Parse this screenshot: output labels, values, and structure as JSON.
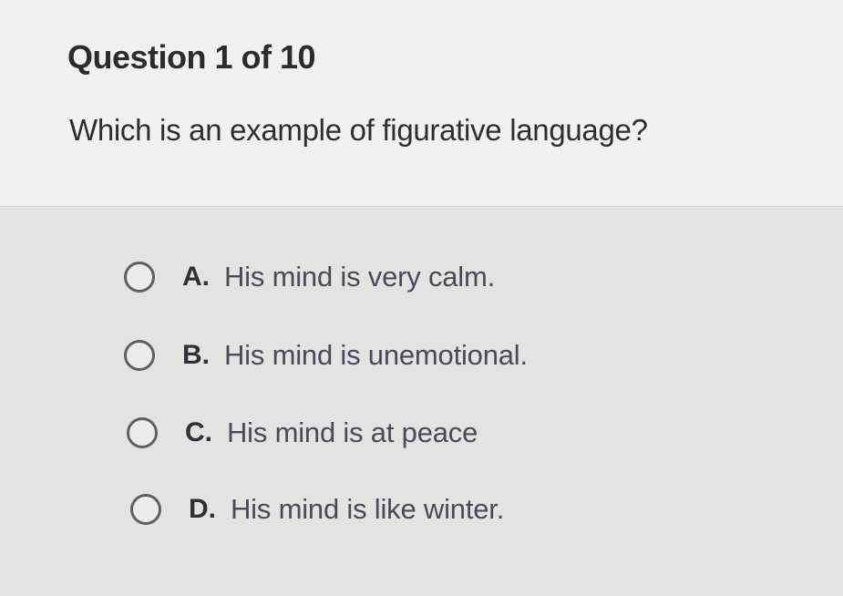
{
  "question": {
    "counter": "Question 1 of 10",
    "prompt": "Which is an example of figurative language?"
  },
  "options": [
    {
      "letter": "A.",
      "text": "His mind is very calm."
    },
    {
      "letter": "B.",
      "text": "His mind is unemotional."
    },
    {
      "letter": "C.",
      "text": "His mind is at peace"
    },
    {
      "letter": "D.",
      "text": "His mind is like winter."
    }
  ]
}
